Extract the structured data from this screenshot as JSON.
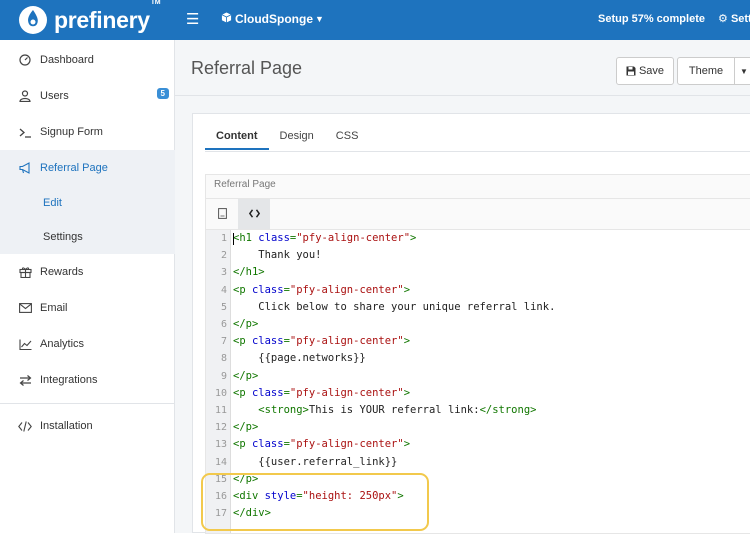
{
  "topbar": {
    "logo": "prefinery",
    "logo_tm": "TM",
    "account_name": "CloudSponge",
    "setup_progress": "Setup 57% complete",
    "settings_label": "Settings"
  },
  "sidebar": {
    "items": [
      {
        "label": "Dashboard",
        "icon": "dashboard-icon"
      },
      {
        "label": "Users",
        "icon": "user-icon",
        "badge": "5"
      },
      {
        "label": "Signup Form",
        "icon": "terminal-icon"
      },
      {
        "label": "Referral Page",
        "icon": "megaphone-icon",
        "active": true
      },
      {
        "label": "Rewards",
        "icon": "gift-icon"
      },
      {
        "label": "Email",
        "icon": "envelope-icon"
      },
      {
        "label": "Analytics",
        "icon": "line-chart-icon"
      },
      {
        "label": "Integrations",
        "icon": "exchange-icon"
      },
      {
        "label": "Installation",
        "icon": "code-icon"
      }
    ],
    "subitems": [
      {
        "label": "Edit",
        "current": true
      },
      {
        "label": "Settings",
        "current": false
      }
    ]
  },
  "main": {
    "title": "Referral Page",
    "save_label": "Save",
    "theme_label": "Theme",
    "tabs": [
      {
        "label": "Content",
        "active": true
      },
      {
        "label": "Design",
        "active": false
      },
      {
        "label": "CSS",
        "active": false
      }
    ],
    "field_label": "Referral Page"
  },
  "code_lines": [
    [
      {
        "t": "tag",
        "v": "<h1 "
      },
      {
        "t": "attr",
        "v": "class"
      },
      {
        "t": "tag",
        "v": "="
      },
      {
        "t": "str",
        "v": "\"pfy-align-center\""
      },
      {
        "t": "tag",
        "v": ">"
      }
    ],
    [
      {
        "t": "txt",
        "v": "    Thank you!"
      }
    ],
    [
      {
        "t": "tag",
        "v": "</h1>"
      }
    ],
    [
      {
        "t": "tag",
        "v": "<p "
      },
      {
        "t": "attr",
        "v": "class"
      },
      {
        "t": "tag",
        "v": "="
      },
      {
        "t": "str",
        "v": "\"pfy-align-center\""
      },
      {
        "t": "tag",
        "v": ">"
      }
    ],
    [
      {
        "t": "txt",
        "v": "    Click below to share your unique referral link."
      }
    ],
    [
      {
        "t": "tag",
        "v": "</p>"
      }
    ],
    [
      {
        "t": "tag",
        "v": "<p "
      },
      {
        "t": "attr",
        "v": "class"
      },
      {
        "t": "tag",
        "v": "="
      },
      {
        "t": "str",
        "v": "\"pfy-align-center\""
      },
      {
        "t": "tag",
        "v": ">"
      }
    ],
    [
      {
        "t": "txt",
        "v": "    {{page.networks}}"
      }
    ],
    [
      {
        "t": "tag",
        "v": "</p>"
      }
    ],
    [
      {
        "t": "tag",
        "v": "<p "
      },
      {
        "t": "attr",
        "v": "class"
      },
      {
        "t": "tag",
        "v": "="
      },
      {
        "t": "str",
        "v": "\"pfy-align-center\""
      },
      {
        "t": "tag",
        "v": ">"
      }
    ],
    [
      {
        "t": "txt",
        "v": "    "
      },
      {
        "t": "tag",
        "v": "<strong>"
      },
      {
        "t": "txt",
        "v": "This is YOUR referral link:"
      },
      {
        "t": "tag",
        "v": "</strong>"
      }
    ],
    [
      {
        "t": "tag",
        "v": "</p>"
      }
    ],
    [
      {
        "t": "tag",
        "v": "<p "
      },
      {
        "t": "attr",
        "v": "class"
      },
      {
        "t": "tag",
        "v": "="
      },
      {
        "t": "str",
        "v": "\"pfy-align-center\""
      },
      {
        "t": "tag",
        "v": ">"
      }
    ],
    [
      {
        "t": "txt",
        "v": "    {{user.referral_link}}"
      }
    ],
    [
      {
        "t": "tag",
        "v": "</p>"
      }
    ],
    [
      {
        "t": "tag",
        "v": "<div "
      },
      {
        "t": "attr",
        "v": "style"
      },
      {
        "t": "tag",
        "v": "="
      },
      {
        "t": "str",
        "v": "\"height: 250px\""
      },
      {
        "t": "tag",
        "v": ">"
      }
    ],
    [
      {
        "t": "tag",
        "v": "</div>"
      }
    ]
  ],
  "colors": {
    "brand": "#1e73be",
    "tag": "#117700",
    "attr": "#0000cc",
    "string": "#aa1111",
    "highlight": "#f2c94c"
  }
}
